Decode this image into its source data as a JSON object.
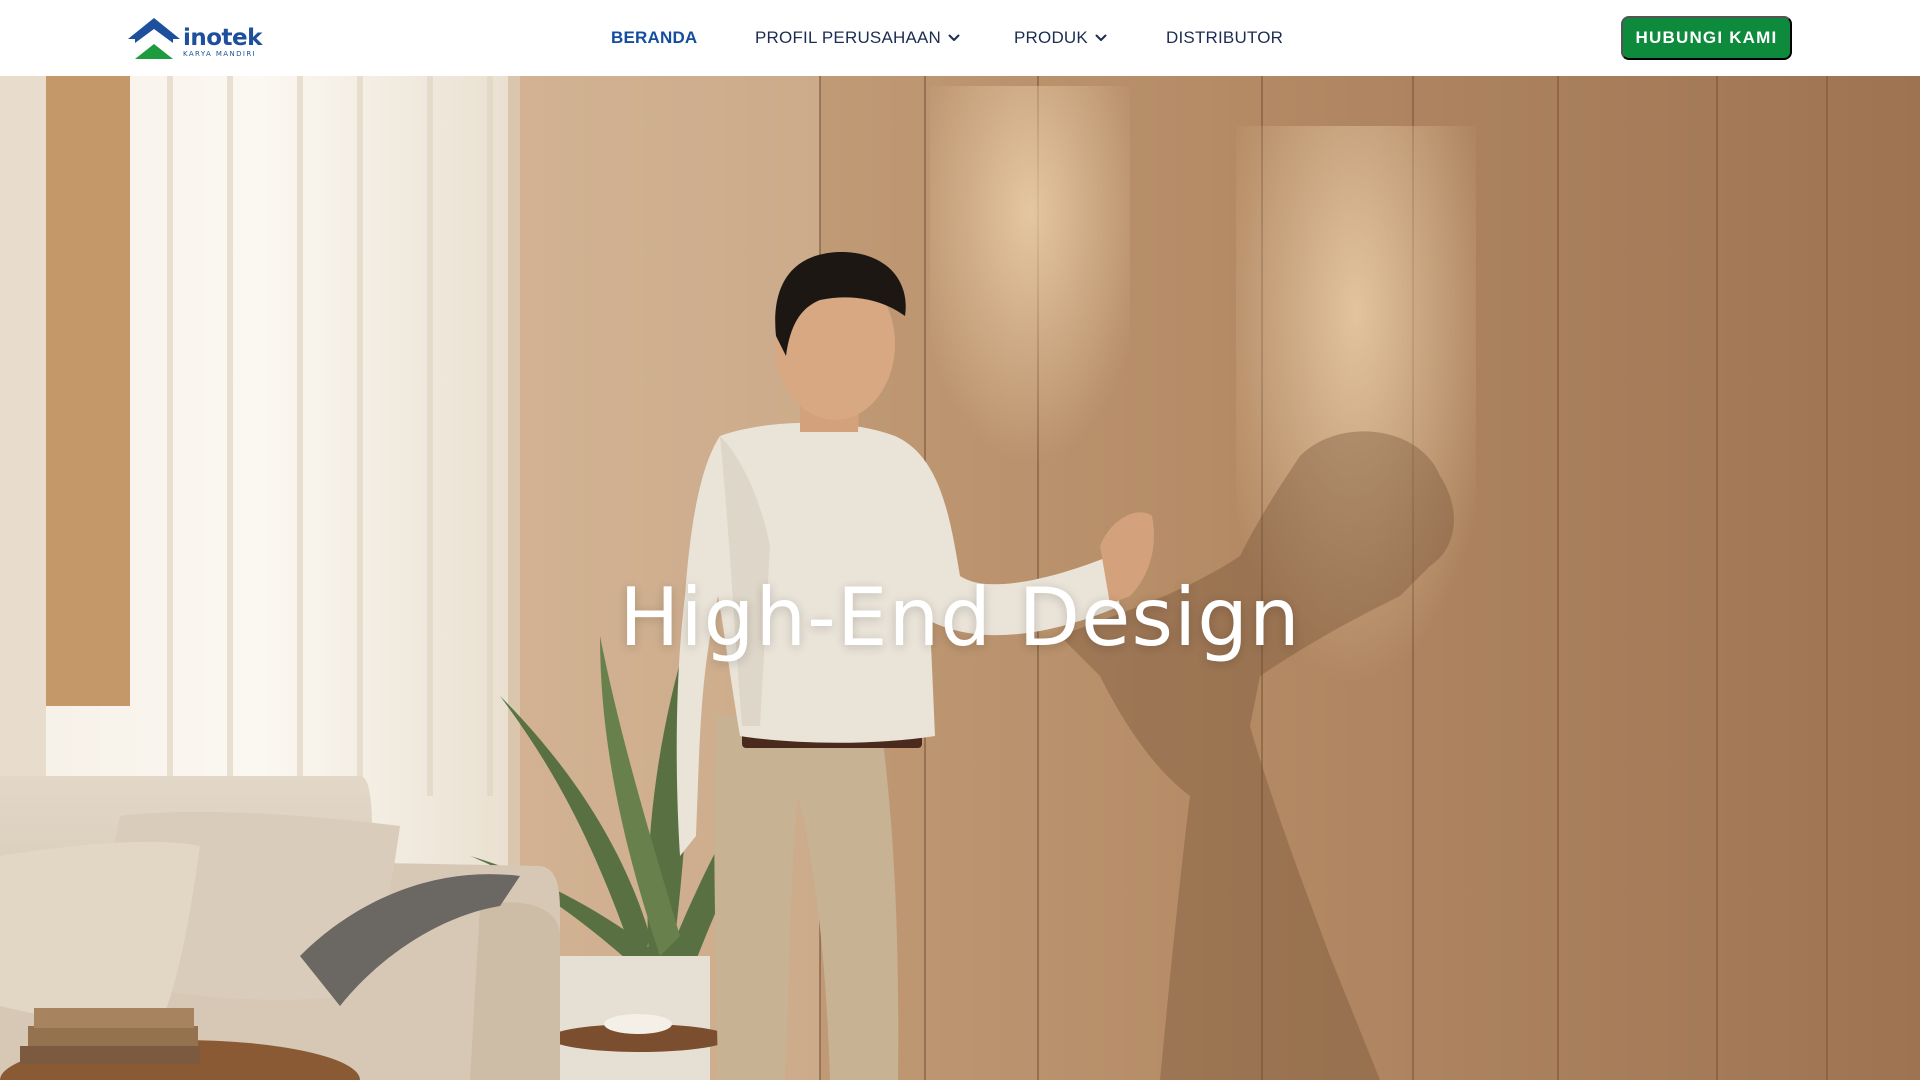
{
  "brand": {
    "name": "inotek",
    "tagline": "KARYA MANDIRI",
    "primary_color": "#1d4f9c",
    "accent_color": "#1e9a3f"
  },
  "nav": {
    "items": [
      {
        "label": "BERANDA",
        "active": true,
        "has_dropdown": false
      },
      {
        "label": "PROFIL PERUSAHAAN",
        "active": false,
        "has_dropdown": true,
        "icon": "chevron-down-icon"
      },
      {
        "label": "PRODUK",
        "active": false,
        "has_dropdown": true,
        "icon": "chevron-down-icon"
      },
      {
        "label": "DISTRIBUTOR",
        "active": false,
        "has_dropdown": false
      }
    ],
    "cta_label": "HUBUNGI KAMI",
    "cta_color": "#0e8a3c"
  },
  "hero": {
    "title": "High-End Design"
  }
}
